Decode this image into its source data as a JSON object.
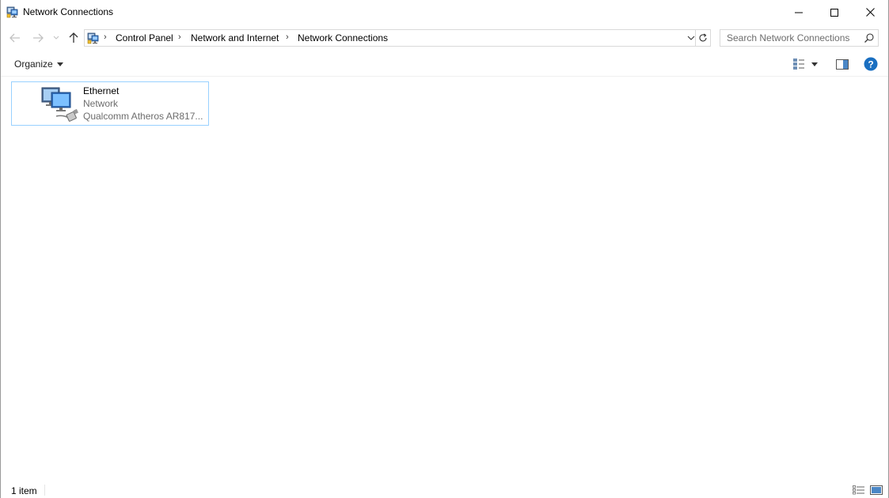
{
  "window": {
    "title": "Network Connections",
    "icon": "network-connections-icon"
  },
  "address": {
    "breadcrumbs": [
      "Control Panel",
      "Network and Internet",
      "Network Connections"
    ]
  },
  "search": {
    "placeholder": "Search Network Connections",
    "value": ""
  },
  "toolbar": {
    "organize_label": "Organize"
  },
  "items": [
    {
      "name": "Ethernet",
      "status": "Network",
      "device": "Qualcomm Atheros AR817...",
      "icon": "ethernet-adapter-icon"
    }
  ],
  "statusbar": {
    "item_count": "1 item"
  },
  "colors": {
    "selection_border": "#99d1ff",
    "help_blue": "#1a6fc1",
    "muted_text": "#6d6d6d"
  }
}
